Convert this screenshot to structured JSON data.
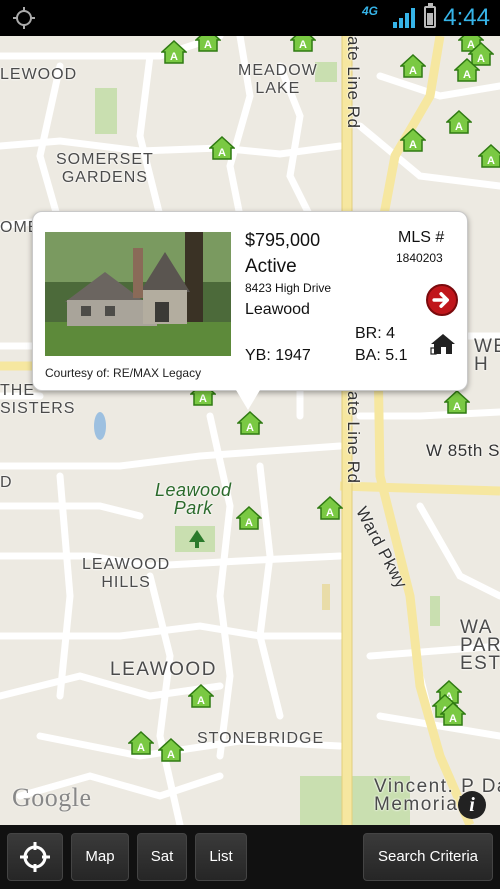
{
  "status_bar": {
    "network": "4G",
    "time": "4:44"
  },
  "map": {
    "labels": {
      "leawood_nw": "LEWOOD",
      "meadow_lake": "MEADOW\nLAKE",
      "somerset_gardens": "SOMERSET\nGARDENS",
      "home": "OME",
      "the_sisters": "THE\nSISTERS",
      "d_left": "D",
      "state_line_top": "ate Line Rd",
      "state_line_mid": "ate Line Rd",
      "w_85th": "W 85th S",
      "we_right": "WE\nH",
      "ward_pkwy": "Ward Pkwy",
      "leawood_park": "Leawood\nPark",
      "leawood_hills": "LEAWOOD\nHILLS",
      "leawood": "LEAWOOD",
      "stonebridge": "STONEBRIDGE",
      "park_esta": "WA\nPARK\nESTA",
      "vincent": "Vincent. P Da\nMemorial",
      "google": "Google"
    }
  },
  "popup": {
    "price": "$795,000",
    "status": "Active",
    "address": "8423 High Drive",
    "city": "Leawood",
    "year_built": "YB: 1947",
    "mls_label": "MLS #",
    "mls_number": "1840203",
    "bedrooms": "BR: 4",
    "bathrooms": "BA: 5.1",
    "courtesy": "Courtesy of: RE/MAX Legacy"
  },
  "toolbar": {
    "map": "Map",
    "sat": "Sat",
    "list": "List",
    "search_criteria": "Search Criteria"
  }
}
